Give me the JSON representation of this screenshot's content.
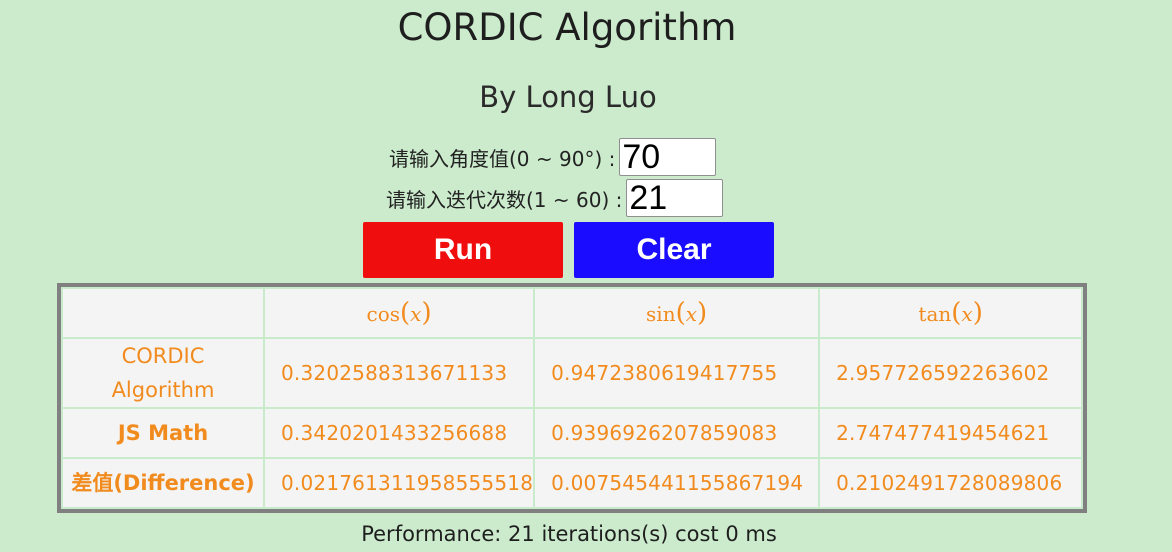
{
  "header": {
    "title": "CORDIC Algorithm",
    "subtitle": "By Long Luo"
  },
  "form": {
    "angle_label": "请输入角度值(0 ~ 90°) :",
    "angle_value": "70",
    "iterations_label": "请输入迭代次数(1 ~ 60) :",
    "iterations_value": "21",
    "run_label": "Run",
    "clear_label": "Clear"
  },
  "colors": {
    "background": "#cbebcc",
    "run_button": "#f00d0d",
    "clear_button": "#1a0dff",
    "table_text": "#f28b1e",
    "table_border": "#808080"
  },
  "table": {
    "columns": [
      {
        "fn": "cos",
        "arg": "x"
      },
      {
        "fn": "sin",
        "arg": "x"
      },
      {
        "fn": "tan",
        "arg": "x"
      }
    ],
    "rows": [
      {
        "label_line1": "CORDIC",
        "label_line2": "Algorithm",
        "values": [
          "0.3202588313671133",
          "0.9472380619417755",
          "2.957726592263602"
        ]
      },
      {
        "label": "JS Math",
        "values": [
          "0.3420201433256688",
          "0.9396926207859083",
          "2.747477419454621"
        ]
      },
      {
        "label": "差值(Difference)",
        "values": [
          "0.021761311958555518",
          "0.007545441155867194",
          "0.2102491728089806"
        ]
      }
    ]
  },
  "performance": {
    "text": "Performance: 21 iterations(s) cost 0 ms",
    "iterations": 21,
    "cost_ms": 0
  }
}
